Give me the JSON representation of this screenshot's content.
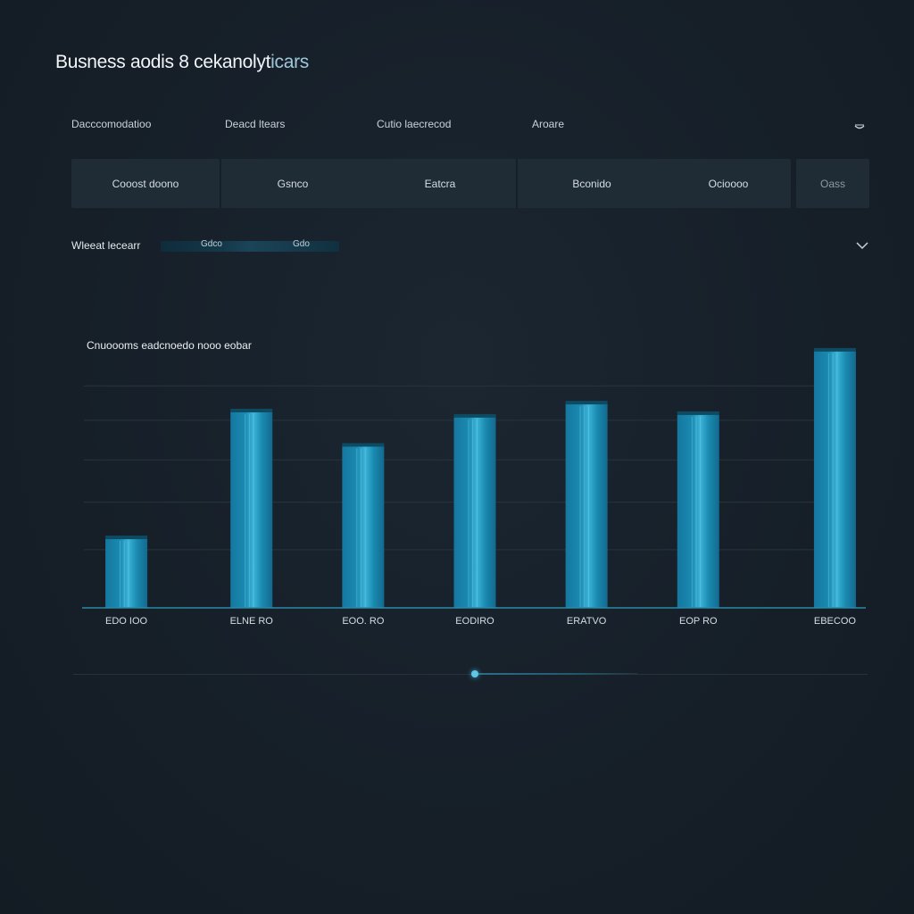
{
  "header": {
    "title_main": "Busness aodis ",
    "title_mid": "8 cekanolyt",
    "title_accent": "icars"
  },
  "nav": {
    "items": [
      {
        "label": "Dacccomodatioo"
      },
      {
        "label": "Deacd ltears"
      },
      {
        "label": "Cutio laecrecod"
      },
      {
        "label": "Aroare"
      }
    ],
    "toggle_icon": "chevron-up-icon"
  },
  "tabs": {
    "items": [
      {
        "label": "Cooost doono"
      },
      {
        "label": "Gsnco"
      },
      {
        "label": "Eatcra"
      },
      {
        "label": "Bconido"
      },
      {
        "label": "Ocioooo"
      }
    ],
    "extra_label": "Oass"
  },
  "filter": {
    "label": "Wleeat lecearr",
    "chip_1": "Gdco",
    "chip_2": "Gdo",
    "chevron_icon": "chevron-down-icon"
  },
  "colors": {
    "background": "#17202a",
    "bar": "#1a8ab0",
    "bar_highlight": "#3cb3d8",
    "grid": "#26343e",
    "accent": "#5fc6e6"
  },
  "chart_data": {
    "type": "bar",
    "title": "Cnuoooms eadcnoedo nooo eobar",
    "categories": [
      "EDO IOO",
      "ELNE RO",
      "EOO. RO",
      "EODIRO",
      "ERATVO",
      "EOP RO",
      "EBECOO"
    ],
    "values": [
      26,
      74,
      61,
      72,
      77,
      73,
      97
    ],
    "ylim": [
      0,
      100
    ],
    "grid": true,
    "gridline_values": [
      22,
      40,
      56,
      71,
      84
    ]
  }
}
